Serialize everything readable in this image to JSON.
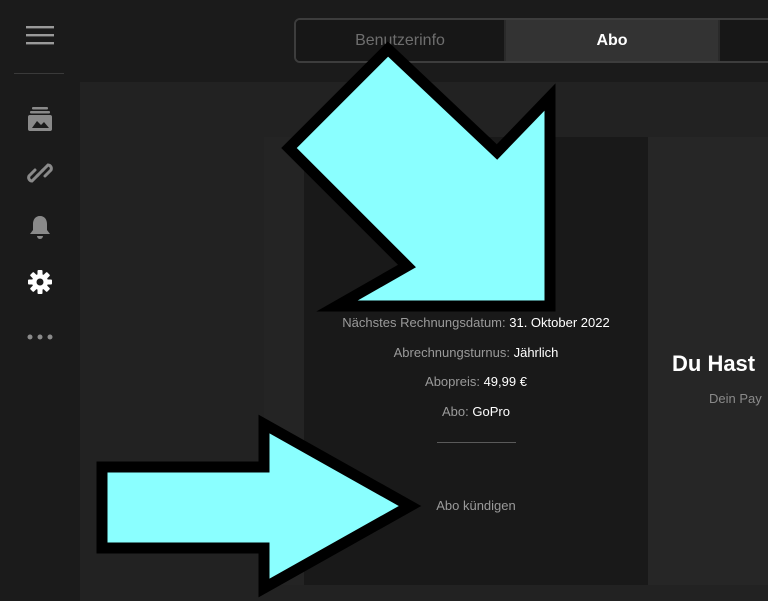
{
  "sidebar": {
    "items": [
      {
        "icon": "menu-icon"
      },
      {
        "icon": "media-library-icon"
      },
      {
        "icon": "link-icon"
      },
      {
        "icon": "bell-icon"
      },
      {
        "icon": "gear-icon"
      },
      {
        "icon": "more-icon"
      }
    ]
  },
  "tabs": [
    {
      "label": "Benutzerinfo"
    },
    {
      "label": "Abo",
      "active": true
    },
    {
      "label": ""
    }
  ],
  "subscription": {
    "next_billing_label": "Nächstes Rechnungsdatum:",
    "next_billing_value": "31. Oktober 2022",
    "billing_cycle_label": "Abrechnungsturnus:",
    "billing_cycle_value": "Jährlich",
    "price_label": "Abopreis:",
    "price_value": "49,99 €",
    "plan_label": "Abo:",
    "plan_value": "GoPro",
    "cancel_label": "Abo kündigen"
  },
  "promo": {
    "title": "Du Hast",
    "subtitle": "Dein Pay"
  },
  "colors": {
    "arrow_fill": "#8affff",
    "arrow_outline": "#000000",
    "background": "#1b1b1b",
    "card": "#191919"
  }
}
